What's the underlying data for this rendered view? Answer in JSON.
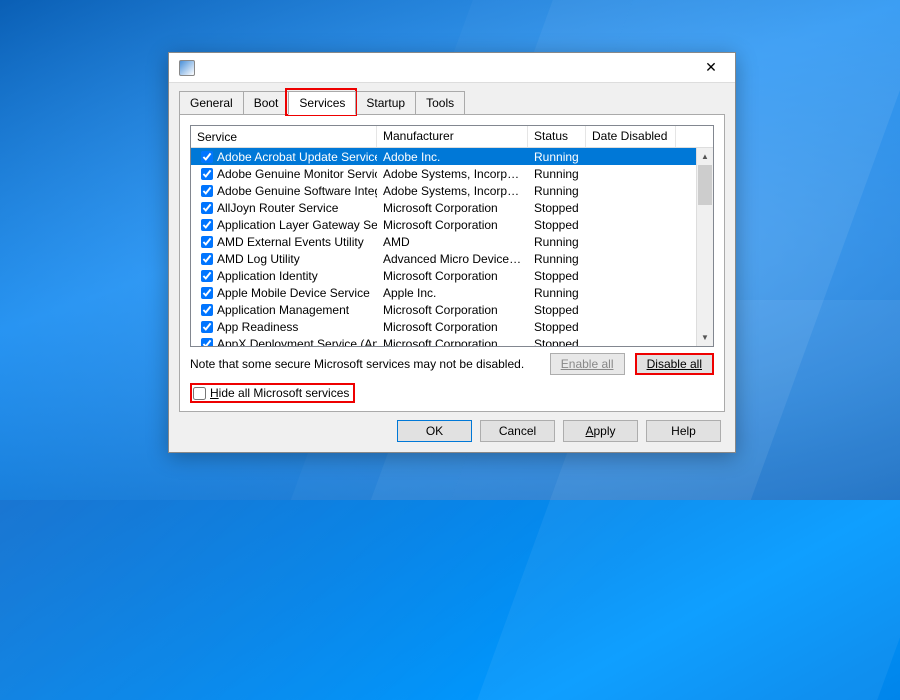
{
  "tabs": [
    "General",
    "Boot",
    "Services",
    "Startup",
    "Tools"
  ],
  "active_tab": 2,
  "columns": {
    "service": "Service",
    "manufacturer": "Manufacturer",
    "status": "Status",
    "date_disabled": "Date Disabled"
  },
  "services": [
    {
      "checked": true,
      "name": "Adobe Acrobat Update Service",
      "mfr": "Adobe Inc.",
      "status": "Running",
      "selected": true
    },
    {
      "checked": true,
      "name": "Adobe Genuine Monitor Service",
      "mfr": "Adobe Systems, Incorpora...",
      "status": "Running"
    },
    {
      "checked": true,
      "name": "Adobe Genuine Software Integri...",
      "mfr": "Adobe Systems, Incorpora...",
      "status": "Running"
    },
    {
      "checked": true,
      "name": "AllJoyn Router Service",
      "mfr": "Microsoft Corporation",
      "status": "Stopped"
    },
    {
      "checked": true,
      "name": "Application Layer Gateway Service",
      "mfr": "Microsoft Corporation",
      "status": "Stopped"
    },
    {
      "checked": true,
      "name": "AMD External Events Utility",
      "mfr": "AMD",
      "status": "Running"
    },
    {
      "checked": true,
      "name": "AMD Log Utility",
      "mfr": "Advanced Micro Devices, I...",
      "status": "Running"
    },
    {
      "checked": true,
      "name": "Application Identity",
      "mfr": "Microsoft Corporation",
      "status": "Stopped"
    },
    {
      "checked": true,
      "name": "Apple Mobile Device Service",
      "mfr": "Apple Inc.",
      "status": "Running"
    },
    {
      "checked": true,
      "name": "Application Management",
      "mfr": "Microsoft Corporation",
      "status": "Stopped"
    },
    {
      "checked": true,
      "name": "App Readiness",
      "mfr": "Microsoft Corporation",
      "status": "Stopped"
    },
    {
      "checked": true,
      "name": "AppX Deployment Service (AppX...",
      "mfr": "Microsoft Corporation",
      "status": "Stopped"
    }
  ],
  "note": "Note that some secure Microsoft services may not be disabled.",
  "buttons": {
    "enable_all": "Enable all",
    "disable_all": "Disable all",
    "ok": "OK",
    "cancel": "Cancel",
    "apply": "Apply",
    "help": "Help"
  },
  "hide_ms": {
    "label": "Hide all Microsoft services",
    "checked": false
  }
}
